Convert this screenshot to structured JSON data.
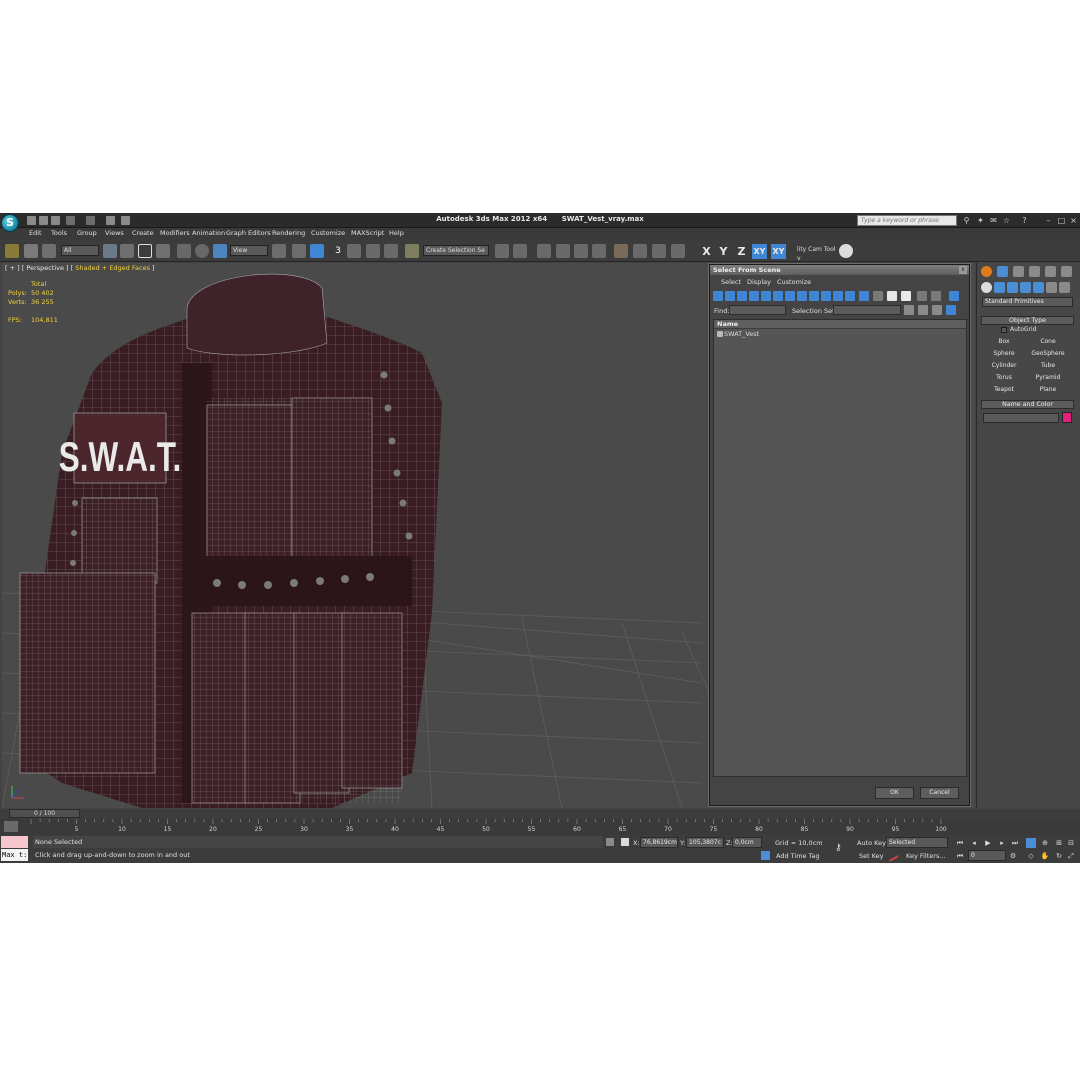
{
  "app": {
    "title": "Autodesk 3ds Max  2012 x64",
    "file": "SWAT_Vest_vray.max",
    "search_placeholder": "Type a keyword or phrase",
    "logo_letter": "S"
  },
  "menu": [
    "Edit",
    "Tools",
    "Group",
    "Views",
    "Create",
    "Modifiers",
    "Animation",
    "Graph Editors",
    "Rendering",
    "Customize",
    "MAXScript",
    "Help"
  ],
  "toolbar": {
    "filter": "All",
    "ref_coord": "View",
    "snap_num": "3",
    "named_selection": "Create Selection Se",
    "axis": [
      "X",
      "Y",
      "Z",
      "XY",
      "XY"
    ],
    "utility_label": "lity Cam Tool v"
  },
  "viewport": {
    "label_prefix": "[ + ] [ ",
    "view_name": "Perspective",
    "label_mid": " ] [ ",
    "shading": "Shaded + Edged Faces",
    "label_suffix": " ]",
    "stats": {
      "total_label": "Total",
      "polys_label": "Polys:",
      "polys": "50 402",
      "verts_label": "Verts:",
      "verts": "36 255",
      "fps_label": "FPS:",
      "fps": "104,811"
    },
    "model_text": "S.W.A.T.",
    "colors": {
      "bg": "#4a4a4a",
      "grid": "#5f5f5f",
      "vest": "#3a1d22",
      "wire": "#8f8f8f"
    }
  },
  "dialog": {
    "title": "Select From Scene",
    "close": "x",
    "menus": [
      "Select",
      "Display",
      "Customize"
    ],
    "find_label": "Find:",
    "selection_set_label": "Selection Set:",
    "column_name": "Name",
    "items": [
      "SWAT_Vest"
    ],
    "ok": "OK",
    "cancel": "Cancel"
  },
  "command_panel": {
    "category": "Standard Primitives",
    "object_type_header": "Object Type",
    "autogrid": "AutoGrid",
    "primitives": [
      "Box",
      "Cone",
      "Sphere",
      "GeoSphere",
      "Cylinder",
      "Tube",
      "Torus",
      "Pyramid",
      "Teapot",
      "Plane"
    ],
    "name_color_header": "Name and Color",
    "object_color": "#e3207c"
  },
  "timeline": {
    "frame": "0 / 100",
    "ticks": [
      "5",
      "10",
      "15",
      "20",
      "25",
      "30",
      "35",
      "40",
      "45",
      "50",
      "55",
      "60",
      "65",
      "70",
      "75",
      "80",
      "85",
      "90",
      "95",
      "100"
    ],
    "first_tick": "0"
  },
  "status": {
    "maxscript": "Max t:",
    "selection": "None Selected",
    "prompt": "Click and drag up-and-down to zoom in and out",
    "x_label": "X:",
    "x_value": "76,8619cm",
    "y_label": "Y:",
    "y_value": "105,3807c",
    "z_label": "Z:",
    "z_value": "0,0cm",
    "grid": "Grid = 10,0cm",
    "add_time_tag": "Add Time Tag",
    "auto_key": "Auto Key",
    "set_key": "Set Key",
    "key_mode": "Selected",
    "key_filters": "Key Filters...",
    "current_frame": "0"
  }
}
